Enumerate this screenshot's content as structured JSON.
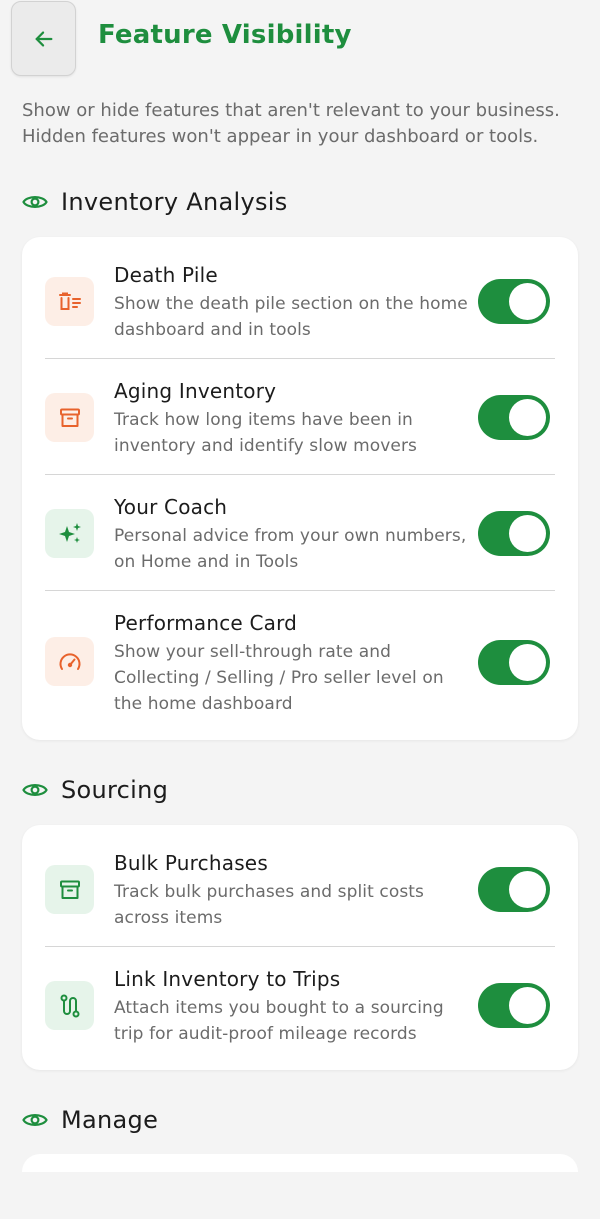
{
  "header": {
    "title": "Feature Visibility"
  },
  "intro": "Show or hide features that aren't relevant to your business. Hidden features won't appear in your dashboard or tools.",
  "sections": [
    {
      "title": "Inventory Analysis",
      "items": [
        {
          "title": "Death Pile",
          "description": "Show the death pile section on the home dashboard and in tools",
          "icon": "trash-list-icon",
          "enabled": true
        },
        {
          "title": "Aging Inventory",
          "description": "Track how long items have been in inventory and identify slow movers",
          "icon": "archive-box-icon",
          "enabled": true
        },
        {
          "title": "Your Coach",
          "description": "Personal advice from your own numbers, on Home and in Tools",
          "icon": "sparkles-icon",
          "enabled": true
        },
        {
          "title": "Performance Card",
          "description": "Show your sell-through rate and Collecting / Selling / Pro seller level on the home dashboard",
          "icon": "gauge-icon",
          "enabled": true
        }
      ]
    },
    {
      "title": "Sourcing",
      "items": [
        {
          "title": "Bulk Purchases",
          "description": "Track bulk purchases and split costs across items",
          "icon": "archive-box-icon",
          "enabled": true
        },
        {
          "title": "Link Inventory to Trips",
          "description": "Attach items you bought to a sourcing trip for audit-proof mileage records",
          "icon": "route-icon",
          "enabled": true
        }
      ]
    },
    {
      "title": "Manage",
      "items": []
    }
  ],
  "colors": {
    "accent": "#1e8e3e",
    "orange_icon": "#e8622c",
    "orange_bg": "#fdeee6",
    "green_bg": "#e6f4ea"
  }
}
